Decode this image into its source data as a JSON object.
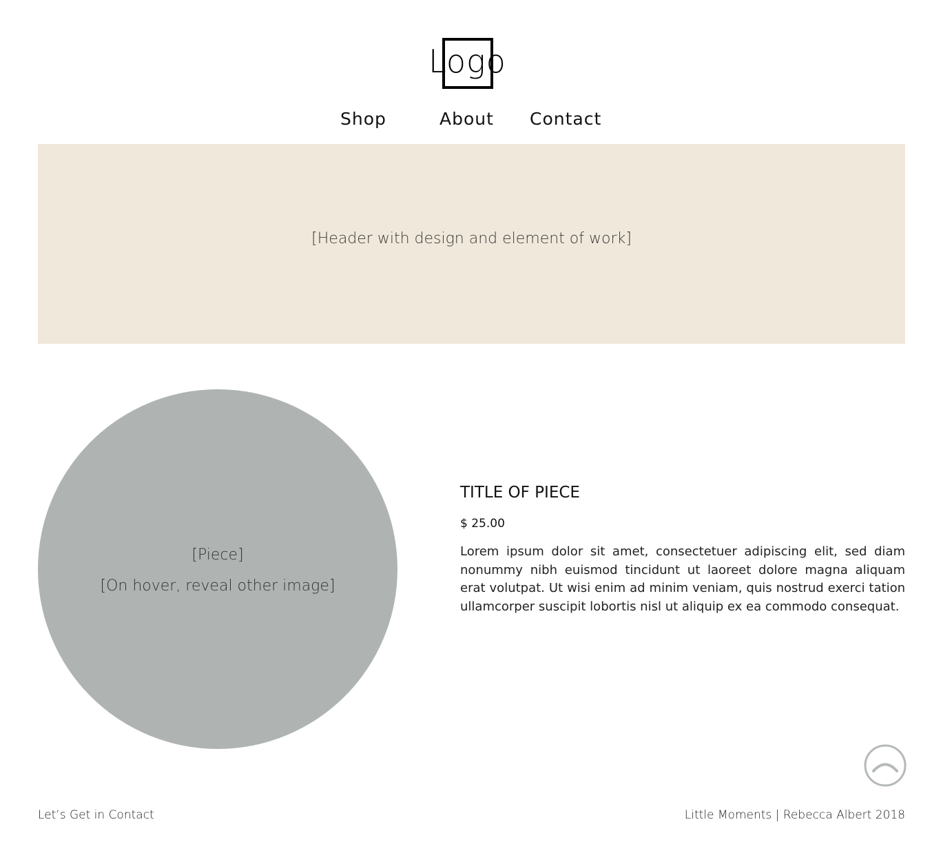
{
  "logo": {
    "text": "Logo"
  },
  "nav": {
    "items": [
      {
        "label": "Shop"
      },
      {
        "label": "About"
      },
      {
        "label": "Contact"
      }
    ]
  },
  "hero": {
    "placeholder": "[Header with design and element of work]",
    "background": "#f0e8da"
  },
  "piece": {
    "image_label": "[Piece]",
    "hover_label": "[On hover, reveal other image]",
    "circle_color": "#afb4b3",
    "title": "TITLE OF PIECE",
    "price": "$ 25.00",
    "description": "Lorem ipsum dolor sit amet, consectetuer adipiscing elit, sed diam nonummy nibh euismod tincidunt ut laoreet dolore magna ali­quam erat volutpat. Ut wisi enim ad minim veniam, quis nostrud exerci tation ullamcorper suscipit lobortis nisl ut aliquip ex ea com­modo consequat."
  },
  "back_to_top": {
    "icon": "chevron-up-circle-icon",
    "color": "#b5b9b8"
  },
  "footer": {
    "contact_link": "Let’s Get in Contact",
    "credit": "Little Moments | Rebecca Albert 2018"
  }
}
